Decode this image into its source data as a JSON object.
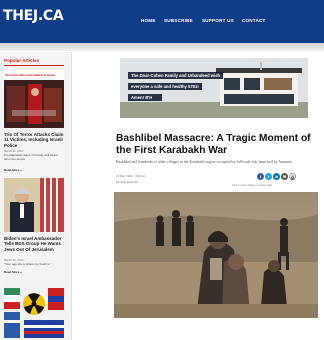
{
  "site": {
    "logo": "THEJ.CA",
    "nav": [
      "HOME",
      "SUBSCRIBE",
      "SUPPORT US",
      "CONTACT"
    ]
  },
  "sidebar": {
    "title": "Popular Articles",
    "articles": [
      {
        "thumb_caption": "Terrorists kill seven attack in Israel",
        "headline": "Trio Of Terror Attacks Claim 11 Victims, Including Israeli Police",
        "date": "March 30, 2022",
        "excerpt": "Pre-Ramadan wave of bloody anti-Israel terrorism erupts",
        "more": "Read More »"
      },
      {
        "headline": "Biden's Israel Ambassador Tells BDS Group He Wants Jews Out Of Jerusalem",
        "date": "March 30, 2022",
        "excerpt": "\"Your agenda is where my heart is.\"",
        "more": "Read More »"
      },
      {}
    ]
  },
  "banner": {
    "lines": [
      "The Doar-Cohen Family and Urbandeed wish",
      "everyone a safe and healthy 5781!",
      "Amen! B'H"
    ]
  },
  "article": {
    "title": "Bashlibel Massacre: A Tragic Moment of the First Karabakh War",
    "subtitle": "Bashlibel and hundreds of other villages in the Karabakh region occupied by full-scale war launched by Armenia",
    "date": "22 May 2021 · 9:50 am",
    "author": "By Staff Reporter",
    "share_caption": "Click to share articles on social media",
    "share_icons": [
      "facebook-icon",
      "twitter-icon",
      "linkedin-icon",
      "email-icon",
      "print-icon"
    ]
  }
}
